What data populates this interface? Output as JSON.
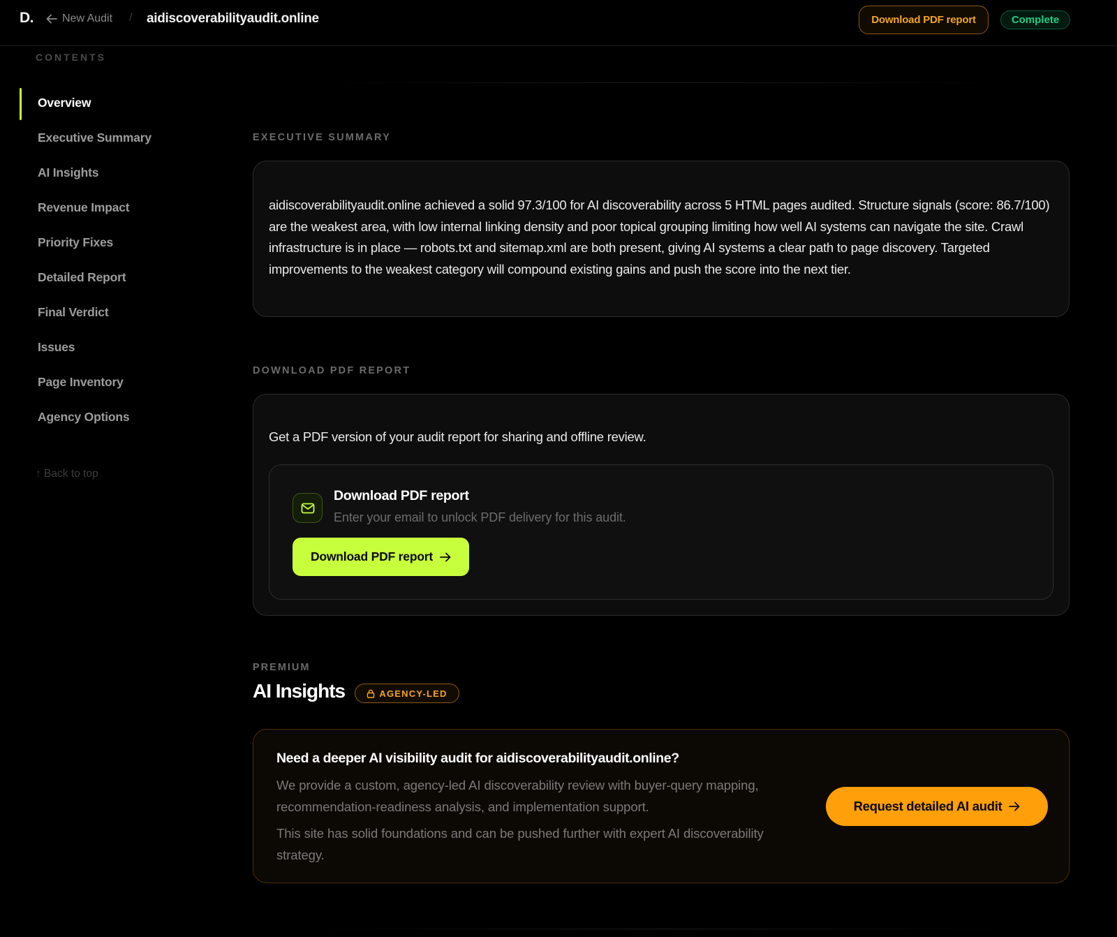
{
  "header": {
    "logo": "D.",
    "back_label": "New Audit",
    "separator": "/",
    "site_title": "aidiscoverabilityaudit.online",
    "download_label": "Download PDF report",
    "status": "Complete",
    "colors": {
      "accent_green": "#c8ff3d",
      "accent_orange": "#ff9f0a",
      "status_green": "#1fcf86"
    }
  },
  "sidebar": {
    "heading": "CONTENTS",
    "items": [
      {
        "label": "Overview",
        "active": true
      },
      {
        "label": "Executive Summary"
      },
      {
        "label": "AI Insights"
      },
      {
        "label": "Revenue Impact"
      },
      {
        "label": "Priority Fixes"
      },
      {
        "label": "Detailed Report"
      },
      {
        "label": "Final Verdict"
      },
      {
        "label": "Issues"
      },
      {
        "label": "Page Inventory"
      },
      {
        "label": "Agency Options"
      }
    ],
    "back_to_top": "↑ Back to top"
  },
  "executive_summary": {
    "label": "EXECUTIVE SUMMARY",
    "text": "aidiscoverabilityaudit.online achieved a solid 97.3/100 for AI discoverability across 5 HTML pages audited. Structure signals (score: 86.7/100) are the weakest area, with low internal linking density and poor topical grouping limiting how well AI systems can navigate the site. Crawl infrastructure is in place — robots.txt and sitemap.xml are both present, giving AI systems a clear path to page discovery. Targeted improvements to the weakest category will compound existing gains and push the score into the next tier."
  },
  "pdf_report": {
    "label": "DOWNLOAD PDF REPORT",
    "intro": "Get a PDF version of your audit report for sharing and offline review.",
    "card_title": "Download PDF report",
    "card_subtitle": "Enter your email to unlock PDF delivery for this audit.",
    "button_label": "Download PDF report",
    "icon": "mail-icon"
  },
  "ai_insights": {
    "premium_label": "PREMIUM",
    "heading": "AI Insights",
    "badge": "AGENCY-LED",
    "cta_title": "Need a deeper AI visibility audit for aidiscoverabilityaudit.online?",
    "cta_body": "We provide a custom, agency-led AI discoverability review with buyer-query mapping, recommendation-readiness analysis, and implementation support.",
    "cta_body2": "This site has solid foundations and can be pushed further with expert AI discoverability strategy.",
    "cta_button": "Request detailed AI audit"
  }
}
